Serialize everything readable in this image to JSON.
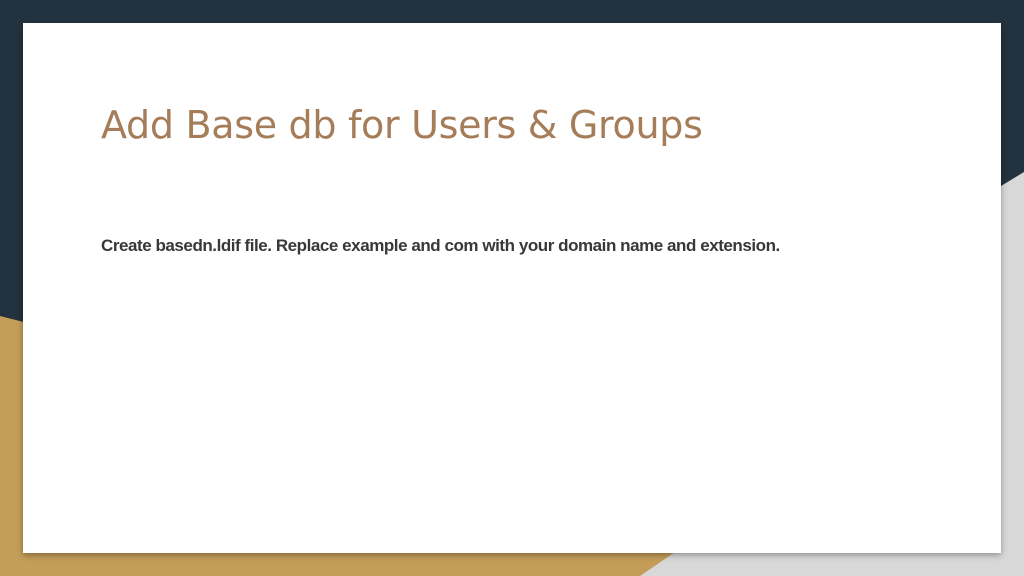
{
  "slide": {
    "title": "Add Base db for Users & Groups",
    "body": "Create basedn.ldif file. Replace example and com with your domain name and extension."
  },
  "colors": {
    "background_dark": "#22333f",
    "accent_gold": "#c49d58",
    "accent_grey": "#d8d8d8",
    "card": "#ffffff",
    "title_text": "#a57d58",
    "body_text": "#383838"
  }
}
